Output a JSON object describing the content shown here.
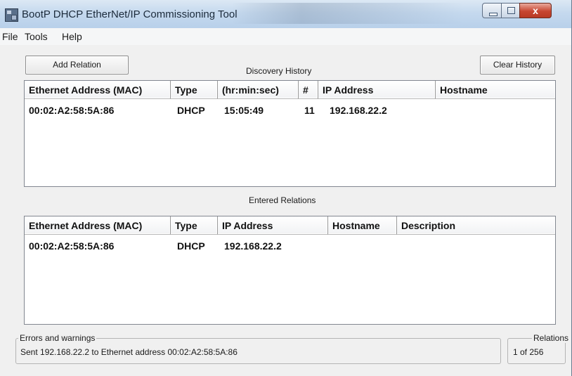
{
  "window": {
    "title": "BootP DHCP EtherNet/IP Commissioning Tool",
    "controls": {
      "close_glyph": "x"
    }
  },
  "menu": [
    "File",
    "Tools",
    "Help"
  ],
  "toolbar": {
    "add_relation_label": "Add Relation",
    "clear_history_label": "Clear History"
  },
  "discovery_history": {
    "caption": "Discovery History",
    "columns": [
      "Ethernet Address (MAC)",
      "Type",
      "(hr:min:sec)",
      "#",
      "IP Address",
      "Hostname"
    ],
    "rows": [
      [
        "00:02:A2:58:5A:86",
        "DHCP",
        "15:05:49",
        "11",
        "192.168.22.2",
        ""
      ]
    ]
  },
  "entered_relations": {
    "caption": "Entered Relations",
    "columns": [
      "Ethernet Address (MAC)",
      "Type",
      "IP Address",
      "Hostname",
      "Description"
    ],
    "rows": [
      [
        "00:02:A2:58:5A:86",
        "DHCP",
        "192.168.22.2",
        "",
        ""
      ]
    ]
  },
  "status": {
    "errors_legend": "Errors and warnings",
    "errors_text": "Sent 192.168.22.2 to Ethernet address 00:02:A2:58:5A:86",
    "relations_legend": "Relations",
    "relations_text": "1 of 256"
  },
  "icons": {
    "app": "network-tool-icon",
    "minimize": "minimize-icon",
    "maximize": "maximize-icon",
    "close": "close-icon"
  }
}
